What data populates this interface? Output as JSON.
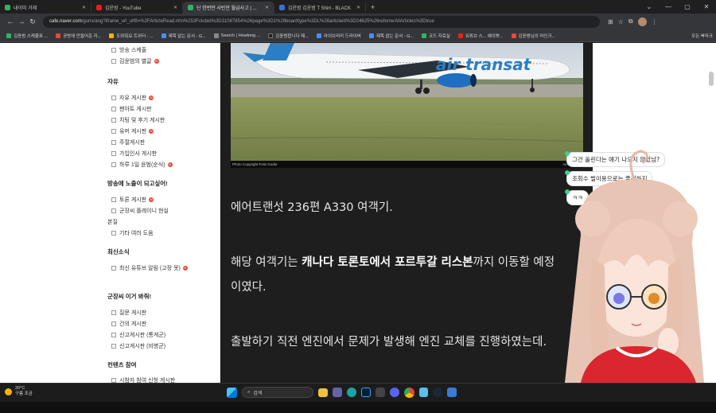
{
  "browser": {
    "tabs": [
      {
        "label": "내이미 가제",
        "color": "#2fb55e"
      },
      {
        "label": "김윤범 - YouTube",
        "color": "#e62117"
      },
      {
        "label": "단 한번만 사빈만 월급사고 | ...",
        "color": "#2fb55e"
      },
      {
        "label": "김윤범 김윤범 T Shirt - BLACK",
        "color": "#3b6fd4"
      }
    ],
    "url_host": "cafe.naver.com",
    "url_path": "/gunsrang?iframe_url_utf8=%2FArticleRead.nhn%253Fclubid%3D31087854%26page%3D1%26boardtype%3DL%26articleid%3D24625%26referrerAllArticles%3Dtrue",
    "bookmarks": [
      {
        "label": "김윤범 스케쥴표 ...",
        "color": "#2fb55e"
      },
      {
        "label": "공방에 만들어준 자...",
        "color": "#e6473b"
      },
      {
        "label": "도와줘요 트위터 - ...",
        "color": "#f4b400"
      },
      {
        "label": "제목 없는 문서 - G...",
        "color": "#4a8cf7"
      },
      {
        "label": "Search | Howlong ...",
        "color": "#888888"
      },
      {
        "label": "김윤범합니다 제...",
        "color": "#222222"
      },
      {
        "label": "라이브러리 드라이버",
        "color": "#4a8cf7"
      },
      {
        "label": "제목 없는 문서 - G...",
        "color": "#4a8cf7"
      },
      {
        "label": "코드 자료실",
        "color": "#2fb55e"
      },
      {
        "label": "유튜브 스... 얘이뽀...",
        "color": "#e62117"
      },
      {
        "label": "김윤범님의 마인크...",
        "color": "#e6473b"
      }
    ],
    "bookmarks_more": "모든 북마크"
  },
  "sidebar": {
    "top_items": [
      {
        "label": "방송 스케줄",
        "new": false
      },
      {
        "label": "김윤범의 별글",
        "new": true
      }
    ],
    "groups": [
      {
        "title": "자유",
        "items": [
          {
            "label": "자유 게시판",
            "new": true
          },
          {
            "label": "팬아트 게시판",
            "new": false
          },
          {
            "label": "치팅 및 후기 게시판",
            "new": false
          },
          {
            "label": "유머 게시판",
            "new": true
          },
          {
            "label": "주절게시판",
            "new": false
          },
          {
            "label": "가입인사 게시판",
            "new": false
          },
          {
            "label": "하루 1일 윤범(순식)",
            "new": true
          }
        ]
      },
      {
        "title": "방송에 노출이 되고싶어!",
        "items": [
          {
            "label": "토론 게시판",
            "new": true
          },
          {
            "label": "군장씨 플레이니 현실",
            "new": false
          },
          {
            "label": "본질",
            "new": false
          },
          {
            "label": "기타 여러 도움",
            "new": false
          }
        ]
      },
      {
        "title": "최신소식",
        "items": [
          {
            "label": "최신 유튜브 알림 (고정 못)",
            "new": true
          }
        ]
      },
      {
        "title": "군장씨 이거 봐줘!",
        "items": [
          {
            "label": "질문 게시판",
            "new": false
          },
          {
            "label": "건의 게시판",
            "new": false
          },
          {
            "label": "신고게시판 (통게군)",
            "new": false
          },
          {
            "label": "신고게시판 (비병군)",
            "new": false
          }
        ]
      },
      {
        "title": "컨텐츠 참여",
        "items": [
          {
            "label": "시참자 참여 신청 게시판",
            "new": false
          }
        ]
      }
    ]
  },
  "article": {
    "photo_brand": "air transat",
    "photo_credit_left": "Photo Copyright Felix Goder",
    "photo_credit_right": "Airliners.net",
    "para1": "에어트랜섯 236편 A330 여객기.",
    "para2_prefix": "해당 여객기는 ",
    "para2_bold": "캐나다 토론토에서 포르투갈 리스본",
    "para2_suffix": "까지 이동할 예정",
    "para2_line2": "이였다.",
    "para3": "출발하기 직전 엔진에서 문제가 발생해 엔진 교체를 진행하였는데."
  },
  "chat": [
    {
      "text": "그건 올린다는 얘기 나오지 않았남?"
    },
    {
      "text": "조회수 벌이용으로는 좋긴하지"
    },
    {
      "text": "ㅋㅋ"
    }
  ],
  "taskbar": {
    "weather_temp": "20°C",
    "weather_desc": "구름 조금",
    "search_label": "검색"
  }
}
